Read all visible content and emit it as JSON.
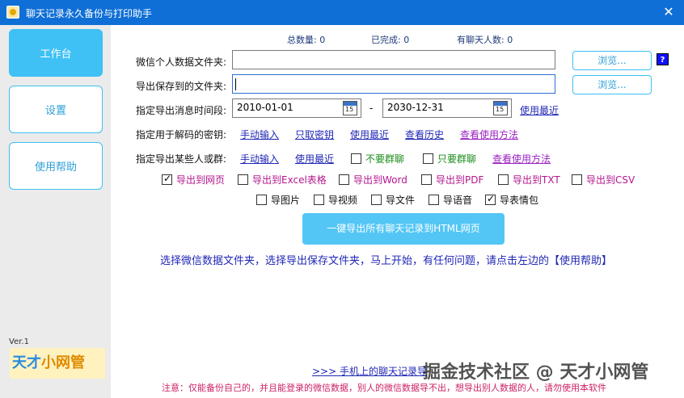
{
  "window": {
    "title": "聊天记录永久备份与打印助手",
    "close_glyph": "✕"
  },
  "sidebar": {
    "items": [
      {
        "label": "工作台",
        "active": true
      },
      {
        "label": "设置",
        "active": false
      },
      {
        "label": "使用帮助",
        "active": false
      }
    ],
    "version": "Ver.1",
    "brand_part1": "天才",
    "brand_part2": "小网管"
  },
  "stats": {
    "total": "总数量:  0",
    "done": "已完成:  0",
    "contacts": "有聊天人数:  0"
  },
  "form": {
    "data_folder_label": "微信个人数据文件夹:",
    "data_folder_value": "",
    "save_folder_label": "导出保存到的文件夹:",
    "save_folder_value": "",
    "browse_label": "浏览...",
    "help_q": "?",
    "date_range_label": "指定导出消息时间段:",
    "date_start": "2010-01-01",
    "date_end": "2030-12-31",
    "date_dash": "-",
    "calendar_day": "15",
    "date_recent_link": "使用最近",
    "key_label": "指定用于解码的密钥:",
    "key_links": [
      "手动输入",
      "只取密钥",
      "使用最近",
      "查看历史"
    ],
    "key_howto": "查看使用方法",
    "people_label": "指定导出某些人或群:",
    "people_links": [
      "手动输入",
      "使用最近"
    ],
    "people_checkboxes": [
      "不要群聊",
      "只要群聊"
    ],
    "people_howto": "查看使用方法"
  },
  "export_formats": [
    {
      "label": "导出到网页",
      "checked": true
    },
    {
      "label": "导出到Excel表格",
      "checked": false
    },
    {
      "label": "导出到Word",
      "checked": false
    },
    {
      "label": "导出到PDF",
      "checked": false
    },
    {
      "label": "导出到TXT",
      "checked": false
    },
    {
      "label": "导出到CSV",
      "checked": false
    }
  ],
  "export_media": [
    {
      "label": "导图片",
      "checked": false
    },
    {
      "label": "导视频",
      "checked": false
    },
    {
      "label": "导文件",
      "checked": false
    },
    {
      "label": "导语音",
      "checked": false
    },
    {
      "label": "导表情包",
      "checked": true
    }
  ],
  "main_button": "一键导出所有聊天记录到HTML网页",
  "hint": "选择微信数据文件夹，选择导出保存文件夹，马上开始，有任何问题，请点击左边的【使用帮助】",
  "mobile_link": ">>>   手机上的聊天记录导",
  "warning": "注意：仅能备份自己的，并且能登录的微信数据，别人的微信数据导不出，想导出别人数据的人，请勿使用本软件",
  "watermark": "掘金技术社区 @ 天才小网管"
}
